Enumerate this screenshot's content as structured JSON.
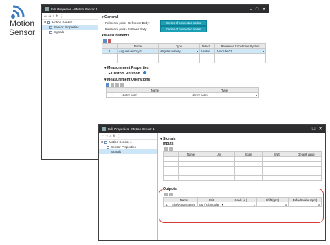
{
  "logo": {
    "line1": "Motion",
    "line2": "Sensor",
    "icon": "wifi-icon",
    "color": "#3d7bbf"
  },
  "window1": {
    "title": "Edit Properties - Motion Sensor 1",
    "tree": [
      {
        "label": "Motion Sensor 1",
        "selected": false
      },
      {
        "label": "Sensor Properties",
        "selected": true
      },
      {
        "label": "Signals",
        "selected": false
      }
    ],
    "general": {
      "header": "General",
      "ref_label": "Reference point - Reference Body:",
      "ref_button": "Center of connected nodes",
      "follow_label": "Reference point - Follower Body:",
      "follow_button": "Center of connected nodes"
    },
    "measurements": {
      "header": "Measurements",
      "columns": [
        "Name",
        "Type",
        "Directi...",
        "Reference Coordinate System"
      ],
      "rows": [
        {
          "num": "1",
          "name": "Angular velocity 1",
          "type": "Angular velocity",
          "direction": "Vector",
          "ref": "Absolute CS"
        }
      ]
    },
    "props_header": "Measurement Properties",
    "custom_rotation": "Custom Rotation",
    "operations": {
      "header": "Measurement Operations",
      "columns": [
        "Name",
        "Type"
      ],
      "rows": [
        {
          "num": "1",
          "name": "Vector norm",
          "type": "Vector norm"
        }
      ]
    }
  },
  "window2": {
    "title": "Edit Properties - Motion Sensor 1",
    "tree": [
      {
        "label": "Motion Sensor 1",
        "selected": false
      },
      {
        "label": "Sensor Properties",
        "selected": false
      },
      {
        "label": "Signals",
        "selected": true
      }
    ],
    "signals_header": "Signals",
    "inputs": {
      "header": "Inputs",
      "columns": [
        "Name",
        "Unit",
        "Scale",
        "Shift",
        "Default value"
      ]
    },
    "outputs": {
      "header": "Outputs",
      "columns": [
        "Name",
        "Unit",
        "Scale (J-)",
        "Shift (rpm)",
        "Default value (rpm)"
      ],
      "rows": [
        {
          "num": "1",
          "name": "ShaftRotarySpeed",
          "unit": "rad / s (Angular",
          "scale": "1",
          "shift": "0",
          "default": "0"
        }
      ]
    }
  },
  "highlight_color": "#d23a3a"
}
